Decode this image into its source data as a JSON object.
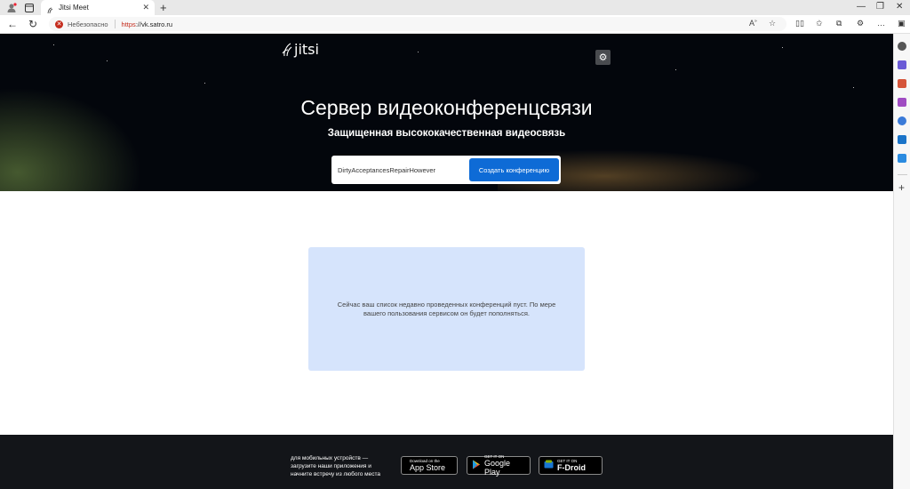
{
  "browser": {
    "tab_title": "Jitsi Meet",
    "security_label": "Небезопасно",
    "url_scheme": "https",
    "url_rest": "://vk.satro.ru",
    "icons": [
      "profile-icon",
      "workspaces-icon",
      "back-icon",
      "refresh-icon",
      "read-aloud-icon",
      "favorite-icon",
      "split-screen-icon",
      "favorites-icon",
      "collections-icon",
      "extensions-icon",
      "more-icon"
    ]
  },
  "hero": {
    "logo": "jitsi",
    "title": "Сервер видеоконференцсвязи",
    "subtitle": "Защищенная высококачественная видеосвязь",
    "room_value": "DirtyAcceptancesRepairHowever",
    "create_label": "Создать конференцию"
  },
  "recent": {
    "empty_text": "Сейчас ваш список недавно проведенных конференций пуст. По мере вашего пользования сервисом он будет пополняться."
  },
  "footer": {
    "mobile_text": "для мобильных устройств — загрузите наши приложения и начните встречу из любого места",
    "appstore_small": "Download on the",
    "appstore_big": "App Store",
    "googleplay_small": "GET IT ON",
    "googleplay_big": "Google Play",
    "fdroid_small": "GET IT ON",
    "fdroid_big": "F-Droid"
  },
  "colors": {
    "accent": "#0e6bd6",
    "recent_bg": "#d6e4fc",
    "footer_bg": "#131519",
    "insecure_red": "#c42b1c"
  }
}
